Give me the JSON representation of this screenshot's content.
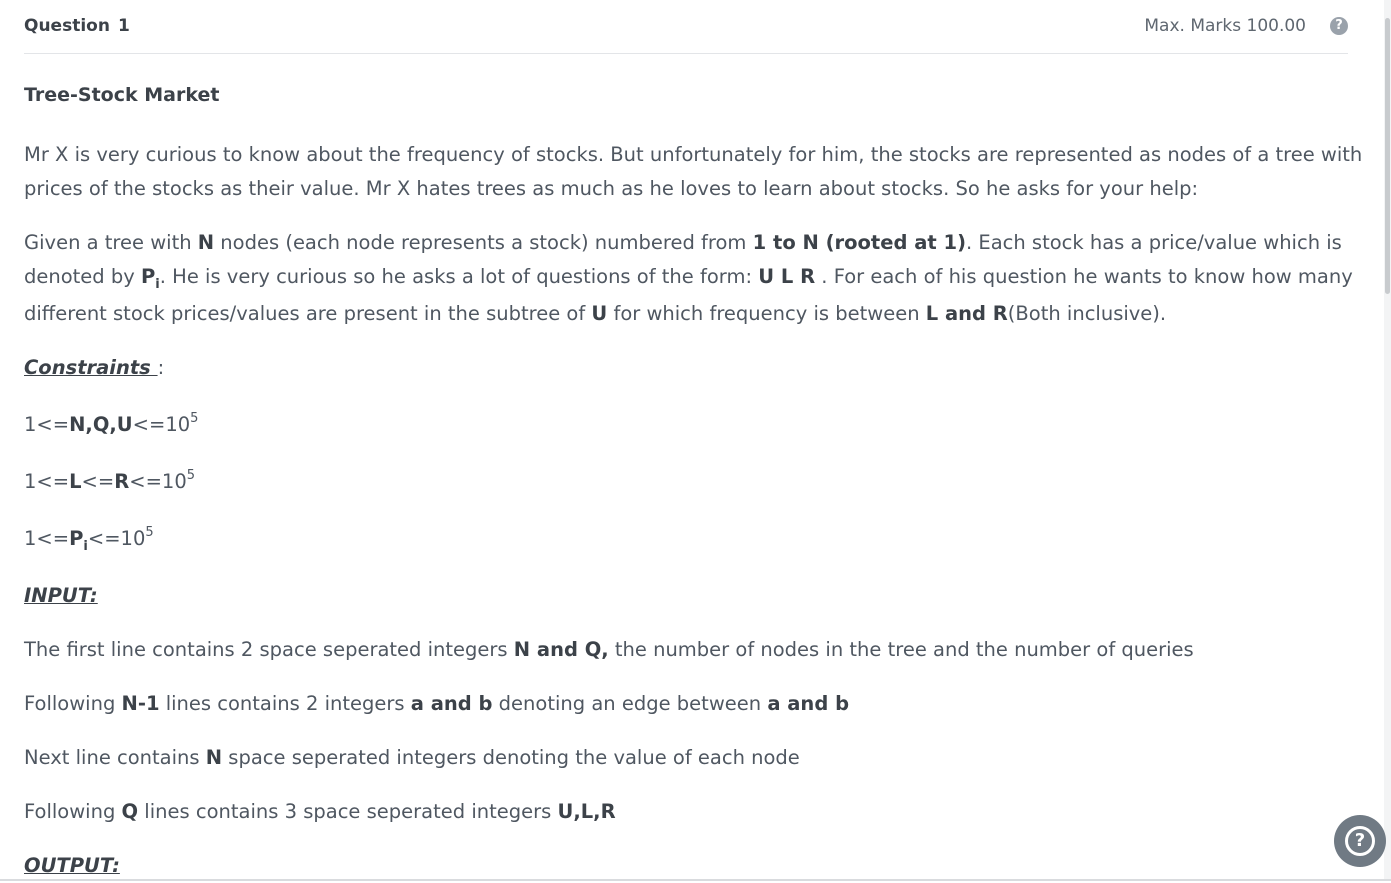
{
  "header": {
    "question_label": "Question",
    "question_number": "1",
    "max_marks": "Max. Marks 100.00",
    "help_glyph": "?"
  },
  "problem": {
    "title": "Tree-Stock Market",
    "intro_line1": "Mr X is very curious to know about the frequency of stocks. But unfortunately for him, the stocks are represented as nodes of a tree with",
    "intro_line2": "prices of the stocks as their value. Mr X hates trees as much as he loves to learn about stocks. So he asks for your help:",
    "desc": {
      "a1": " Given a tree with ",
      "N": "N",
      "a2": " nodes (each node represents a stock) numbered from ",
      "range": "1 to N (rooted at 1)",
      "a3": ". Each stock has a price/value which is",
      "b1": "denoted by ",
      "P": "P",
      "i": "i",
      "b2": ". He is very curious so he asks a lot of questions of the form: ",
      "ULR": "U L R",
      "b3": " . For each of his question he wants to know how many",
      "c1": "different stock prices/values are present in the subtree of ",
      "U": "U",
      "c2": " for which frequency is between ",
      "LR": "L and R",
      "c3": "(Both inclusive)."
    },
    "constraints_heading": "Constraints ",
    "constraints_colon": ":",
    "constraints": {
      "c1_pre": "1<=",
      "c1_vars": "N,Q,U",
      "c1_post": "<=10",
      "c2_pre": "1<=",
      "c2_L": "L",
      "c2_mid": "<=",
      "c2_R": "R",
      "c2_post": "<=10",
      "c3_pre": "1<=",
      "c3_P": "P",
      "c3_i": "i",
      "c3_post": "<=10",
      "exp": "5"
    },
    "input_heading": "INPUT:",
    "input": {
      "l1a": "The first line contains 2 space seperated integers ",
      "l1b": "N and Q,",
      "l1c": " the number of nodes in the tree and the number of queries",
      "l2a": "Following ",
      "l2b": "N-1",
      "l2c": " lines contains 2 integers ",
      "l2d": "a and b",
      "l2e": " denoting an edge between ",
      "l2f": "a and b",
      "l3a": "Next line contains ",
      "l3b": "N",
      "l3c": " space seperated integers denoting the value of each node",
      "l4a": "Following ",
      "l4b": "Q",
      "l4c": " lines contains 3 space seperated integers ",
      "l4d": "U,L,R"
    },
    "output_heading": "OUTPUT:"
  },
  "fab_glyph": "?"
}
